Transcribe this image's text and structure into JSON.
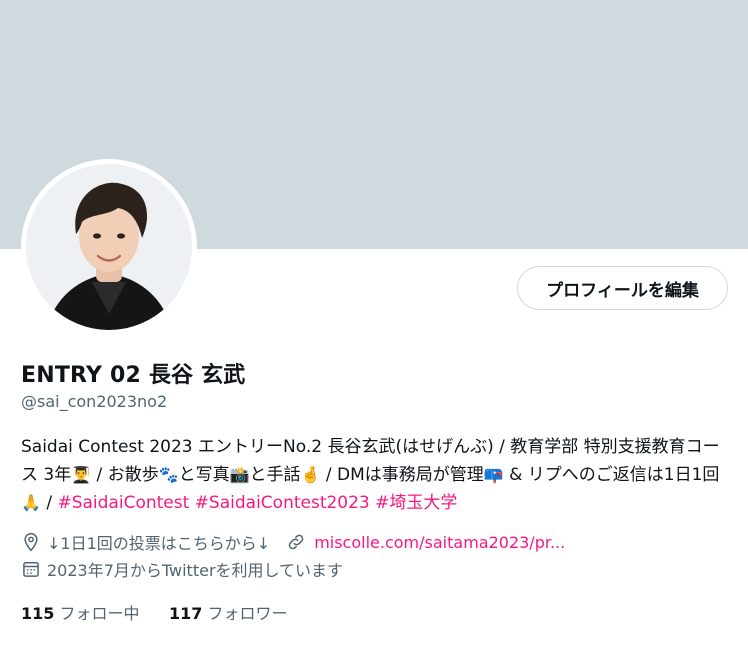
{
  "profile": {
    "edit_button_label": "プロフィールを編集",
    "display_name": "ENTRY 02 長谷 玄武",
    "handle": "@sai_con2023no2",
    "bio": {
      "text_1": "Saidai Contest 2023 エントリーNo.2 長谷玄武(はせげんぶ) / 教育学部 特別支援教育コース 3年",
      "emoji_1": "👨‍🎓",
      "text_2": " / お散歩",
      "emoji_2": "🐾",
      "text_3": "と写真",
      "emoji_3": "📸",
      "text_4": "と手話",
      "emoji_4": "🤞",
      "text_5": " / DMは事務局が管理",
      "emoji_5": "📪",
      "text_6": " & リプへのご返信は1日1回",
      "emoji_6": "🙏",
      "text_7": " / ",
      "hashtags": [
        "#SaidaiContest",
        "#SaidaiContest2023",
        "#埼玉大学"
      ]
    },
    "location": "↓1日1回の投票はこちらから↓",
    "url_text": "miscolle.com/saitama2023/pr...",
    "joined": "2023年7月からTwitterを利用しています",
    "following_count": "115",
    "following_label": "フォロー中",
    "followers_count": "117",
    "followers_label": "フォロワー"
  },
  "colors": {
    "banner": "#cfd9de",
    "accent": "#f91880",
    "secondary_text": "#536471",
    "primary_text": "#0f1419"
  },
  "icons": {
    "location": "location-pin-icon",
    "link": "link-icon",
    "calendar": "calendar-icon"
  }
}
